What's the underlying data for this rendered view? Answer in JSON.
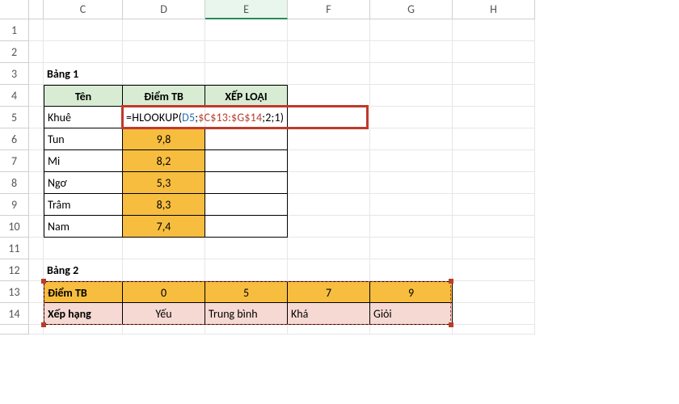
{
  "columns": [
    "",
    "",
    "C",
    "D",
    "E",
    "F",
    "G",
    "H"
  ],
  "active_column": "E",
  "rows": [
    "1",
    "2",
    "3",
    "4",
    "5",
    "6",
    "7",
    "8",
    "9",
    "10",
    "11",
    "12",
    "13",
    "14"
  ],
  "table1": {
    "title": "Bảng 1",
    "headers": {
      "C": "Tên",
      "D": "Điểm TB",
      "E": "XẾP LOẠI"
    },
    "data": [
      {
        "name": "Khuê",
        "score": "",
        "grade_formula": true
      },
      {
        "name": "Tun",
        "score": "9,8",
        "grade": ""
      },
      {
        "name": "Mi",
        "score": "8,2",
        "grade": ""
      },
      {
        "name": "Ngơ",
        "score": "5,3",
        "grade": ""
      },
      {
        "name": "Trâm",
        "score": "8,3",
        "grade": ""
      },
      {
        "name": "Nam",
        "score": "7,4",
        "grade": ""
      }
    ]
  },
  "formula": {
    "prefix": "=",
    "func": "HLOOKUP",
    "open": "(",
    "ref1": "D5",
    "sep1": ";",
    "ref2a": "$C$13:$",
    "ref2b": "G$14",
    "sep2": ";",
    "arg3": "2",
    "sep3": ";",
    "arg4": "1",
    "close": ")"
  },
  "table2": {
    "title": "Bảng 2",
    "row1_label": "Điểm TB",
    "row1": [
      "0",
      "5",
      "7",
      "9"
    ],
    "row2_label": "Xếp hạng",
    "row2": [
      "Yếu",
      "Trung bình",
      "Khá",
      "Giỏi"
    ]
  },
  "chart_data": {
    "type": "table",
    "tables": [
      {
        "name": "Bảng 1",
        "columns": [
          "Tên",
          "Điểm TB",
          "XẾP LOẠI"
        ],
        "rows": [
          [
            "Khuê",
            null,
            "=HLOOKUP(D5;$C$13:$G$14;2;1)"
          ],
          [
            "Tun",
            9.8,
            null
          ],
          [
            "Mi",
            8.2,
            null
          ],
          [
            "Ngơ",
            5.3,
            null
          ],
          [
            "Trâm",
            8.3,
            null
          ],
          [
            "Nam",
            7.4,
            null
          ]
        ]
      },
      {
        "name": "Bảng 2",
        "columns": [
          "Điểm TB",
          "Xếp hạng"
        ],
        "rows": [
          [
            0,
            "Yếu"
          ],
          [
            5,
            "Trung bình"
          ],
          [
            7,
            "Khá"
          ],
          [
            9,
            "Giỏi"
          ]
        ]
      }
    ]
  }
}
